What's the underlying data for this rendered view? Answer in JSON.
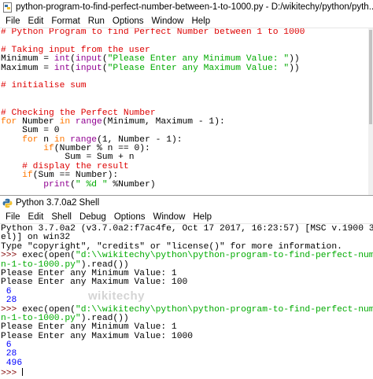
{
  "editor": {
    "title": "python-program-to-find-perfect-number-between-1-to-1000.py - D:/wikitechy/python/pyth...",
    "menu": [
      "File",
      "Edit",
      "Format",
      "Run",
      "Options",
      "Window",
      "Help"
    ],
    "lines": [
      [
        [
          "c-comment",
          "# Python Program to find Perfect Number between 1 to 1000"
        ]
      ],
      [
        [
          "c-default",
          ""
        ]
      ],
      [
        [
          "c-comment",
          "# Taking input from the user"
        ]
      ],
      [
        [
          "c-default",
          "Minimum = "
        ],
        [
          "c-builtin",
          "int"
        ],
        [
          "c-default",
          "("
        ],
        [
          "c-builtin",
          "input"
        ],
        [
          "c-default",
          "("
        ],
        [
          "c-str",
          "\"Please Enter any Minimum Value: \""
        ],
        [
          "c-default",
          "))"
        ]
      ],
      [
        [
          "c-default",
          "Maximum = "
        ],
        [
          "c-builtin",
          "int"
        ],
        [
          "c-default",
          "("
        ],
        [
          "c-builtin",
          "input"
        ],
        [
          "c-default",
          "("
        ],
        [
          "c-str",
          "\"Please Enter any Maximum Value: \""
        ],
        [
          "c-default",
          "))"
        ]
      ],
      [
        [
          "c-default",
          ""
        ]
      ],
      [
        [
          "c-comment",
          "# initialise sum"
        ]
      ],
      [
        [
          "c-default",
          ""
        ]
      ],
      [
        [
          "c-default",
          ""
        ]
      ],
      [
        [
          "c-comment",
          "# Checking the Perfect Number"
        ]
      ],
      [
        [
          "c-kw",
          "for"
        ],
        [
          "c-default",
          " Number "
        ],
        [
          "c-kw",
          "in"
        ],
        [
          "c-default",
          " "
        ],
        [
          "c-builtin",
          "range"
        ],
        [
          "c-default",
          "(Minimum, Maximum - 1):"
        ]
      ],
      [
        [
          "c-default",
          "    Sum = 0"
        ]
      ],
      [
        [
          "c-default",
          "    "
        ],
        [
          "c-kw",
          "for"
        ],
        [
          "c-default",
          " n "
        ],
        [
          "c-kw",
          "in"
        ],
        [
          "c-default",
          " "
        ],
        [
          "c-builtin",
          "range"
        ],
        [
          "c-default",
          "(1, Number - 1):"
        ]
      ],
      [
        [
          "c-default",
          "        "
        ],
        [
          "c-kw",
          "if"
        ],
        [
          "c-default",
          "(Number % n == 0):"
        ]
      ],
      [
        [
          "c-default",
          "            Sum = Sum + n"
        ]
      ],
      [
        [
          "c-comment",
          "    # display the result"
        ]
      ],
      [
        [
          "c-default",
          "    "
        ],
        [
          "c-kw",
          "if"
        ],
        [
          "c-default",
          "(Sum == Number):"
        ]
      ],
      [
        [
          "c-default",
          "        "
        ],
        [
          "c-builtin",
          "print"
        ],
        [
          "c-default",
          "("
        ],
        [
          "c-str",
          "\" %d \""
        ],
        [
          "c-default",
          " %Number)"
        ]
      ]
    ]
  },
  "shell": {
    "title": "Python 3.7.0a2 Shell",
    "menu": [
      "File",
      "Edit",
      "Shell",
      "Debug",
      "Options",
      "Window",
      "Help"
    ],
    "lines": [
      [
        [
          "c-default",
          "Python 3.7.0a2 (v3.7.0a2:f7ac4fe, Oct 17 2017, 16:23:57) [MSC v.1900 32 bit (Int"
        ]
      ],
      [
        [
          "c-default",
          "el)] on win32"
        ]
      ],
      [
        [
          "c-default",
          "Type \"copyright\", \"credits\" or \"license()\" for more information."
        ]
      ],
      [
        [
          "c-prompt",
          ">>> "
        ],
        [
          "c-default",
          "exec(open("
        ],
        [
          "c-str",
          "\"d:\\\\wikitechy\\python\\python-program-to-find-perfect-number-betwee"
        ]
      ],
      [
        [
          "c-str",
          "n-1-to-1000.py\""
        ],
        [
          "c-default",
          ").read())"
        ]
      ],
      [
        [
          "c-default",
          "Please Enter any Minimum Value: 1"
        ]
      ],
      [
        [
          "c-default",
          "Please Enter any Maximum Value: 100"
        ]
      ],
      [
        [
          "c-out",
          " 6"
        ]
      ],
      [
        [
          "c-out",
          " 28"
        ]
      ],
      [
        [
          "c-prompt",
          ">>> "
        ],
        [
          "c-default",
          "exec(open("
        ],
        [
          "c-str",
          "\"d:\\\\wikitechy\\python\\python-program-to-find-perfect-number-betwee"
        ]
      ],
      [
        [
          "c-str",
          "n-1-to-1000.py\""
        ],
        [
          "c-default",
          ").read())"
        ]
      ],
      [
        [
          "c-default",
          "Please Enter any Minimum Value: 1"
        ]
      ],
      [
        [
          "c-default",
          "Please Enter any Maximum Value: 1000"
        ]
      ],
      [
        [
          "c-out",
          " 6"
        ]
      ],
      [
        [
          "c-out",
          " 28"
        ]
      ],
      [
        [
          "c-out",
          " 496"
        ]
      ],
      [
        [
          "c-prompt",
          ">>> "
        ]
      ]
    ]
  },
  "watermark": "wikitechy",
  "colors": {
    "comment": "#dd0000",
    "keyword": "#ff7700",
    "string": "#00aa00",
    "builtin": "#900090",
    "output": "#0000ff",
    "prompt": "#800000"
  }
}
